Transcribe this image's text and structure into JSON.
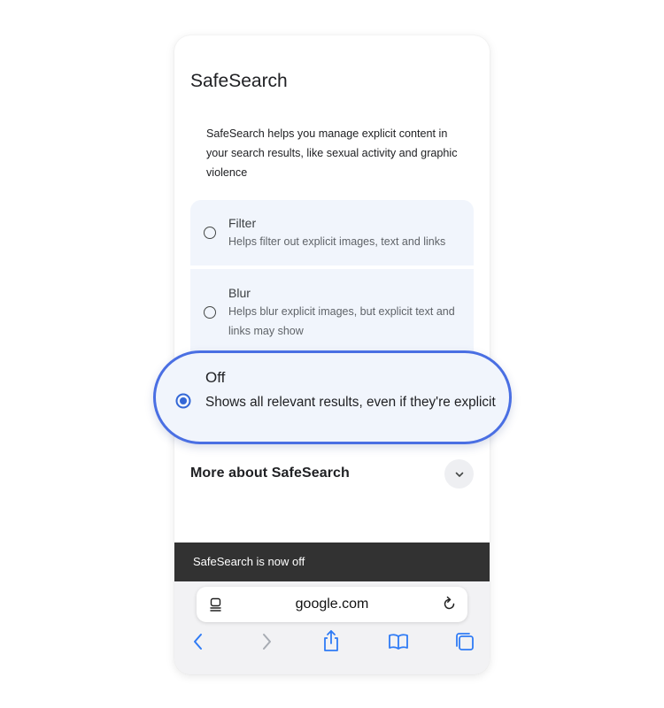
{
  "page": {
    "title": "SafeSearch",
    "description": "SafeSearch helps you manage explicit content in your search results, like sexual activity and graphic violence"
  },
  "options": [
    {
      "title": "Filter",
      "subtitle": "Helps filter out explicit images, text and links",
      "selected": false
    },
    {
      "title": "Blur",
      "subtitle": "Helps blur explicit images, but explicit text and links may show",
      "selected": false
    },
    {
      "title": "Off",
      "subtitle": "Shows all relevant results, even if they're explicit",
      "selected": true
    }
  ],
  "more": {
    "label": "More about SafeSearch",
    "icon": "chevron-down-icon"
  },
  "snackbar": {
    "text": "SafeSearch is now off"
  },
  "browser": {
    "url": "google.com",
    "toolbar_icons": [
      "back-icon",
      "forward-icon",
      "share-icon",
      "bookmarks-icon",
      "tabs-icon"
    ]
  },
  "colors": {
    "accent": "#4a6fe3",
    "radio_selected": "#3367d6",
    "option_bg": "#f1f5fc",
    "snackbar_bg": "#323232"
  }
}
